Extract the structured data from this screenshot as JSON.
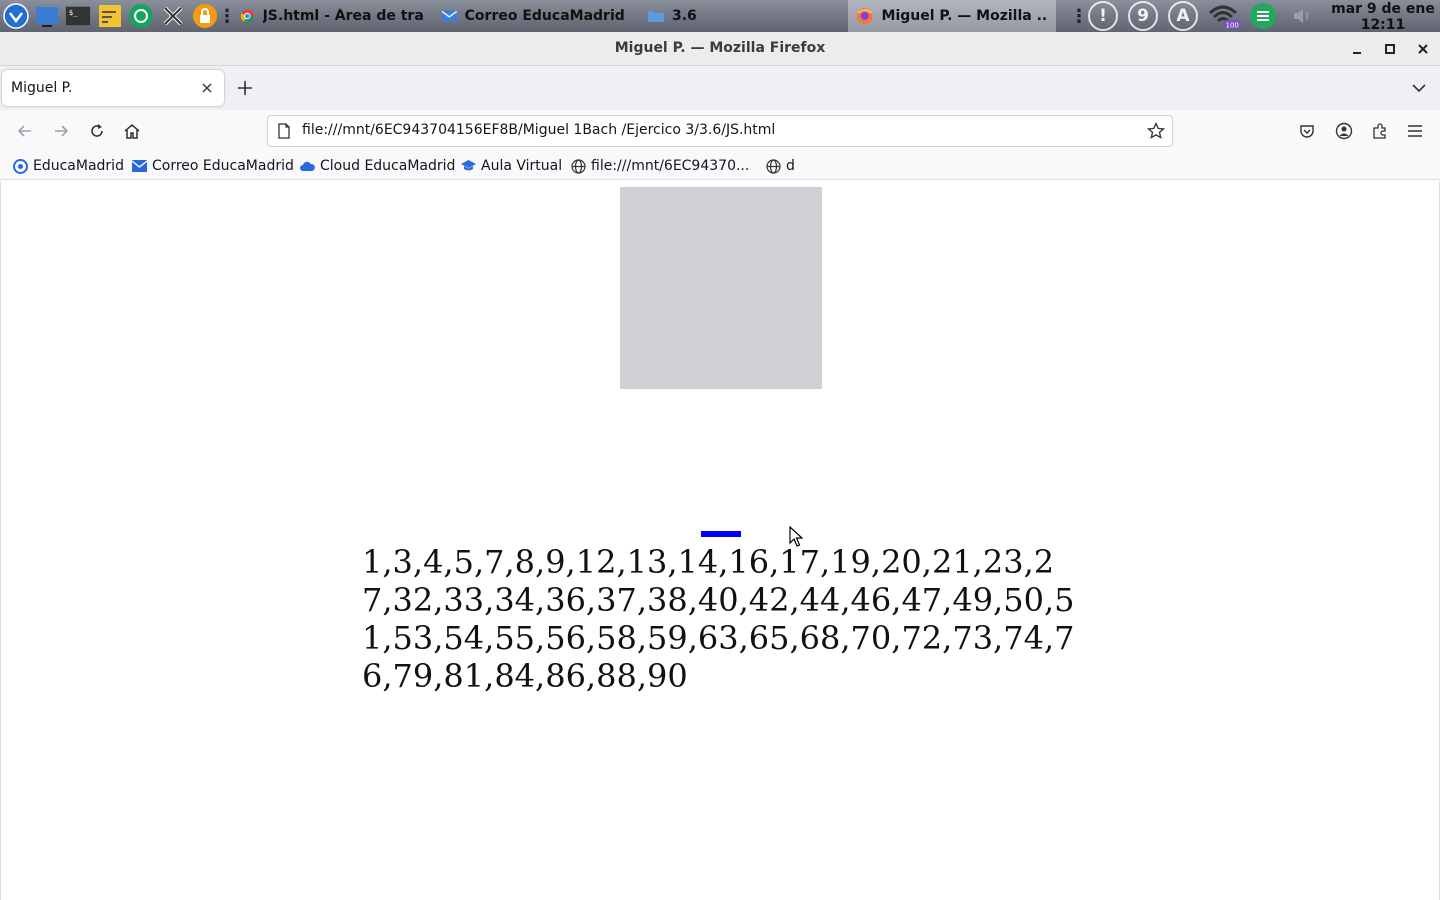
{
  "taskbar": {
    "tasks": [
      {
        "label": "JS.html - Área de tra..."
      },
      {
        "label": "Correo EducaMadrid..."
      },
      {
        "label": "3.6"
      },
      {
        "label": "Miguel P. — Mozilla ..."
      }
    ],
    "tray_digit": "9",
    "tray_letter": "A",
    "battery_level": "100",
    "clock_date": "mar  9 de ene",
    "clock_time": "12:11"
  },
  "window": {
    "title": "Miguel P. — Mozilla Firefox"
  },
  "tabs": [
    {
      "label": "Miguel P."
    }
  ],
  "navbar": {
    "url": "file:///mnt/6EC943704156EF8B/Miguel 1Bach /Ejercico 3/3.6/JS.html"
  },
  "bookmarks": [
    {
      "label": "EducaMadrid",
      "icon": "educamadrid-icon"
    },
    {
      "label": "Correo EducaMadrid",
      "icon": "mail-icon"
    },
    {
      "label": "Cloud EducaMadrid",
      "icon": "cloud-icon"
    },
    {
      "label": "Aula Virtual",
      "icon": "graduation-cap-icon"
    },
    {
      "label": "file:///mnt/6EC94370...",
      "icon": "globe-icon"
    },
    {
      "label": "d",
      "icon": "globe-icon"
    }
  ],
  "page": {
    "numbers": "1,3,4,5,7,8,9,12,13,14,16,17,19,20,21,23,27,32,33,34,36,37,38,40,42,44,46,47,49,50,51,53,54,55,56,58,59,63,65,68,70,72,73,74,76,79,81,84,86,88,90",
    "box_color": "#d0d0d6",
    "bar_color": "#0000ff"
  }
}
